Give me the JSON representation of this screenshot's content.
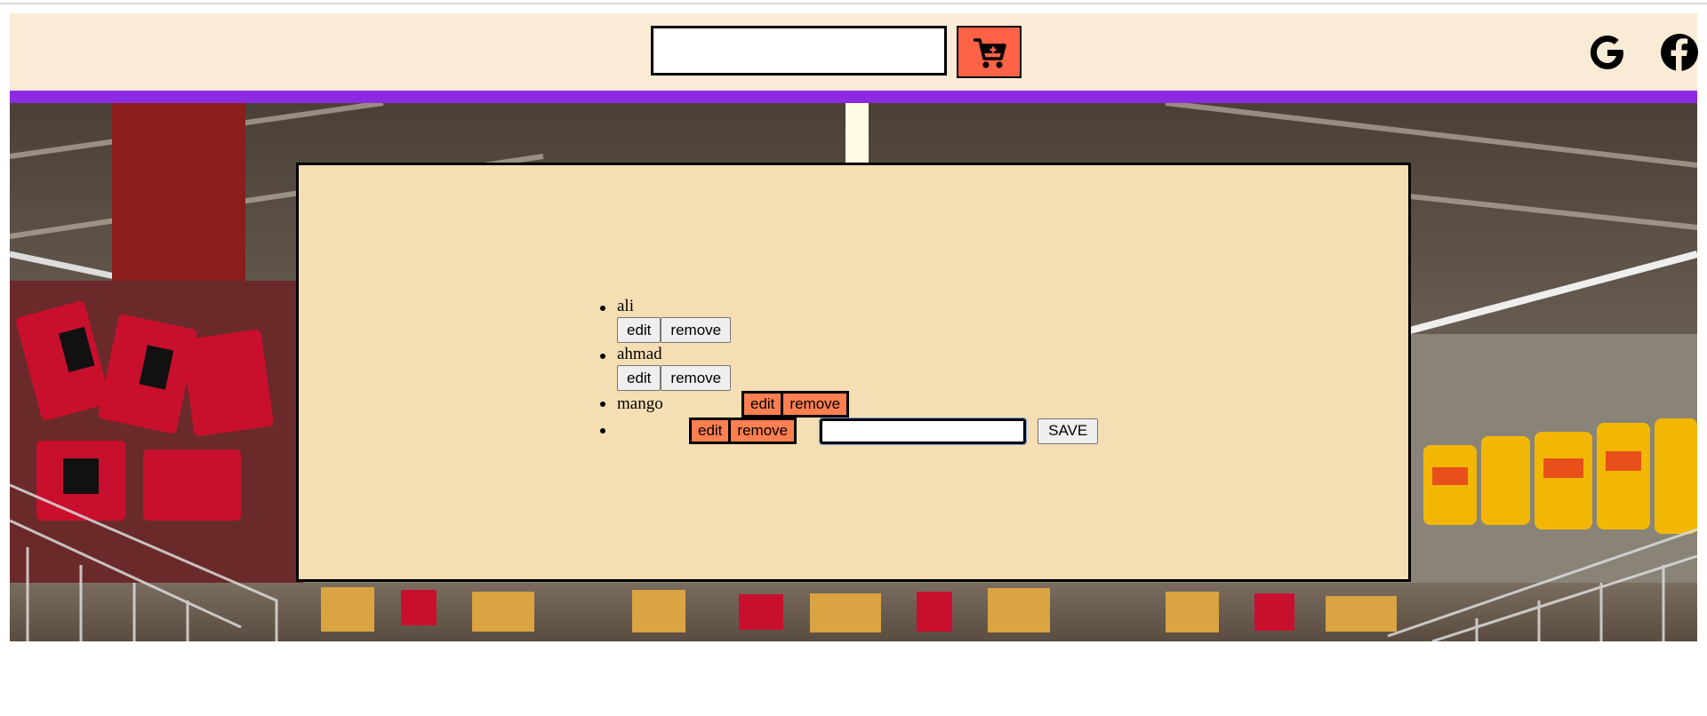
{
  "header": {
    "search": {
      "value": "",
      "placeholder": ""
    },
    "add_button": {
      "icon": "cart-plus-icon",
      "color": "#ff6347"
    },
    "social": [
      {
        "name": "google",
        "icon": "google-icon"
      },
      {
        "name": "facebook",
        "icon": "facebook-icon"
      }
    ],
    "background": "#faebd7",
    "accent_bar": "#8a2be2"
  },
  "hero": {
    "image": "supermarket-aisle-photo"
  },
  "panel": {
    "background": "#f5deb3",
    "items": [
      {
        "label": "ali",
        "edit_label": "edit",
        "remove_label": "remove"
      },
      {
        "label": "ahmad",
        "edit_label": "edit",
        "remove_label": "remove"
      },
      {
        "label": "mango",
        "edit_label": "edit",
        "remove_label": "remove"
      },
      {
        "label": "",
        "edit_label": "edit",
        "remove_label": "remove",
        "input_value": "",
        "save_label": "SAVE"
      }
    ]
  }
}
